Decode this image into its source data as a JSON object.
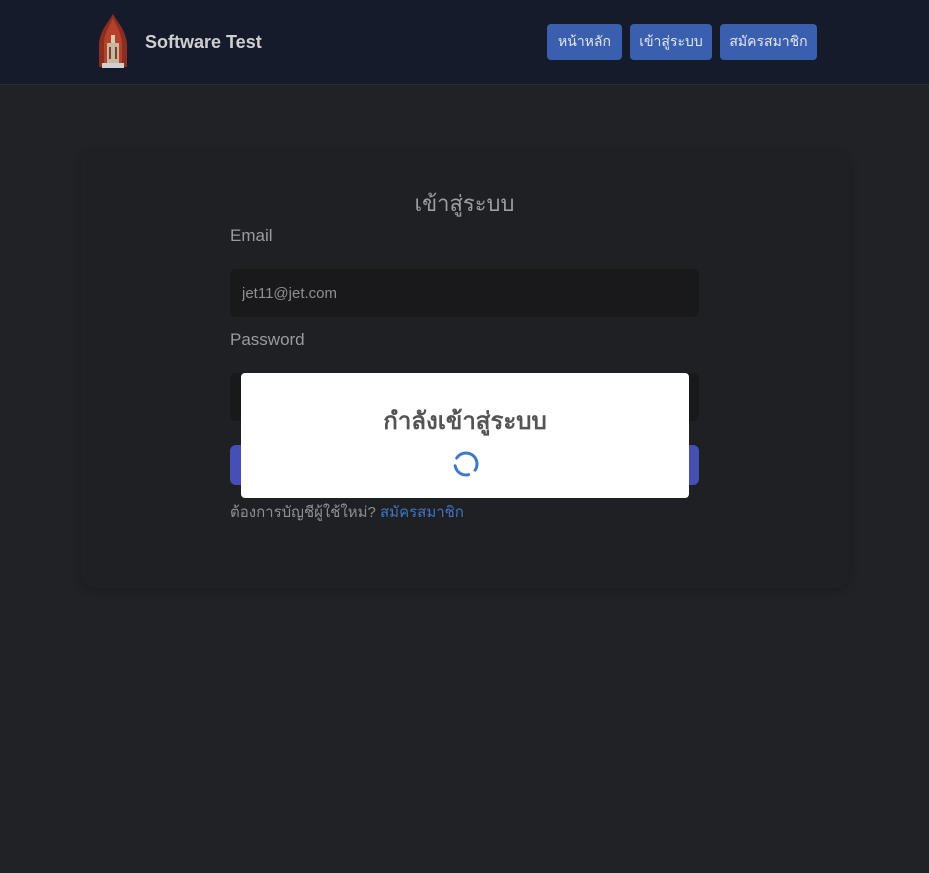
{
  "header": {
    "brand_name": "Software Test",
    "logo_icon": "temple-logo-icon",
    "nav": [
      {
        "label": "หน้าหลัก"
      },
      {
        "label": "เข้าสู่ระบบ"
      },
      {
        "label": "สมัครสมาชิก"
      }
    ]
  },
  "form": {
    "title": "เข้าสู่ระบบ",
    "email_label": "Email",
    "email_value": "jet11@jet.com",
    "password_label": "Password",
    "password_value": "",
    "signup_prompt": "ต้องการบัญชีผู้ใช้ใหม่?",
    "signup_link": "สมัครสมาชิก"
  },
  "modal": {
    "title": "กำลังเข้าสู่ระบบ",
    "spinner_icon": "loading-spinner-icon"
  },
  "colors": {
    "page_bg": "#212226",
    "navbar_bg": "#151b2a",
    "nav_button": "#3a5fae",
    "submit_button": "#4650b4",
    "link": "#3f74c4"
  }
}
